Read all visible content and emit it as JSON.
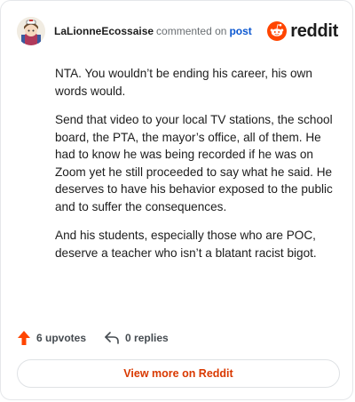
{
  "header": {
    "username": "LaLionneEcossaise",
    "commented_text": "commented on",
    "post_link": "post",
    "logo_text": "reddit"
  },
  "comment": {
    "paragraphs": [
      "NTA. You wouldn’t be ending his career, his own words would.",
      "Send that video to your local TV stations, the school board, the PTA, the mayor’s office, all of them. He had to know he was being recorded if he was on Zoom yet he still proceeded to say what he said. He deserves to have his behavior exposed to the public and to suffer the consequences.",
      "And his students, especially those who are POC, deserve a teacher who isn’t a blatant racist bigot."
    ]
  },
  "actions": {
    "upvotes": "6 upvotes",
    "replies": "0 replies"
  },
  "footer": {
    "view_more": "View more on Reddit"
  },
  "colors": {
    "reddit_orange": "#ff4500",
    "link_blue": "#0b57d0",
    "cta_orange": "#d93900"
  },
  "icons": [
    "avatar-icon",
    "reddit-snoo-icon",
    "upvote-arrow-icon",
    "reply-icon"
  ]
}
